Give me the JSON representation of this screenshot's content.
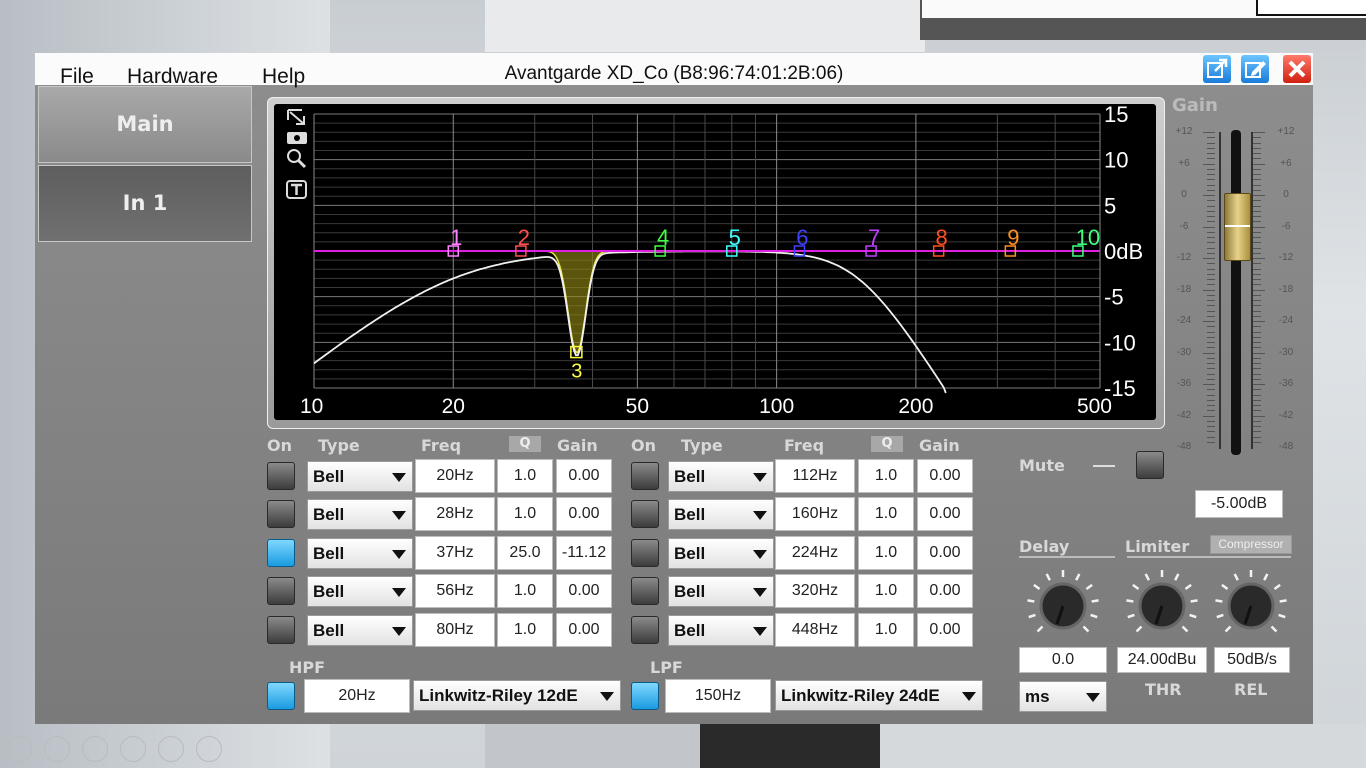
{
  "window": {
    "title": "Avantgarde XD_Co (B8:96:74:01:2B:06)",
    "menu": [
      "File",
      "Hardware",
      "Help"
    ]
  },
  "sidebar": {
    "tabs": [
      "Main",
      "In 1"
    ]
  },
  "graph": {
    "y_ticks": [
      "15",
      "10",
      "5",
      "0dB",
      "-5",
      "-10",
      "-15"
    ],
    "x_ticks": [
      "10",
      "20",
      "50",
      "100",
      "200",
      "500"
    ],
    "markers": [
      {
        "label": "1",
        "color": "#ff80ff",
        "freq": 20,
        "gain": 0
      },
      {
        "label": "2",
        "color": "#ff5050",
        "freq": 28,
        "gain": 0
      },
      {
        "label": "3",
        "color": "#ffff40",
        "freq": 37,
        "gain": -11.12
      },
      {
        "label": "4",
        "color": "#40ff40",
        "freq": 56,
        "gain": 0
      },
      {
        "label": "5",
        "color": "#40ffff",
        "freq": 80,
        "gain": 0
      },
      {
        "label": "6",
        "color": "#4040ff",
        "freq": 112,
        "gain": 0
      },
      {
        "label": "7",
        "color": "#c040ff",
        "freq": 160,
        "gain": 0
      },
      {
        "label": "8",
        "color": "#ff5020",
        "freq": 224,
        "gain": 0
      },
      {
        "label": "9",
        "color": "#ff9020",
        "freq": 320,
        "gain": 0
      },
      {
        "label": "10",
        "color": "#40ff80",
        "freq": 448,
        "gain": 0
      }
    ],
    "tool_icons": [
      "expand-icon",
      "camera-icon",
      "zoom-icon",
      "text-icon"
    ]
  },
  "eq_headers": {
    "on": "On",
    "type": "Type",
    "freq": "Freq",
    "q": "Q",
    "gain": "Gain"
  },
  "eq_left": [
    {
      "on": false,
      "type": "Bell",
      "freq": "20Hz",
      "q": "1.0",
      "gain": "0.00"
    },
    {
      "on": false,
      "type": "Bell",
      "freq": "28Hz",
      "q": "1.0",
      "gain": "0.00"
    },
    {
      "on": true,
      "type": "Bell",
      "freq": "37Hz",
      "q": "25.0",
      "gain": "-11.12"
    },
    {
      "on": false,
      "type": "Bell",
      "freq": "56Hz",
      "q": "1.0",
      "gain": "0.00"
    },
    {
      "on": false,
      "type": "Bell",
      "freq": "80Hz",
      "q": "1.0",
      "gain": "0.00"
    }
  ],
  "eq_right": [
    {
      "on": false,
      "type": "Bell",
      "freq": "112Hz",
      "q": "1.0",
      "gain": "0.00"
    },
    {
      "on": false,
      "type": "Bell",
      "freq": "160Hz",
      "q": "1.0",
      "gain": "0.00"
    },
    {
      "on": false,
      "type": "Bell",
      "freq": "224Hz",
      "q": "1.0",
      "gain": "0.00"
    },
    {
      "on": false,
      "type": "Bell",
      "freq": "320Hz",
      "q": "1.0",
      "gain": "0.00"
    },
    {
      "on": false,
      "type": "Bell",
      "freq": "448Hz",
      "q": "1.0",
      "gain": "0.00"
    }
  ],
  "hpf": {
    "label": "HPF",
    "on": true,
    "freq": "20Hz",
    "type": "Linkwitz-Riley 12dE"
  },
  "lpf": {
    "label": "LPF",
    "on": true,
    "freq": "150Hz",
    "type": "Linkwitz-Riley 24dE"
  },
  "gain": {
    "label": "Gain",
    "scale": [
      "+12",
      "+6",
      "0",
      "-6",
      "-12",
      "-18",
      "-24",
      "-30",
      "-36",
      "-42",
      "-48"
    ],
    "value": "-5.00dB",
    "fader_db": -5
  },
  "mute": {
    "label": "Mute",
    "on": false
  },
  "delay": {
    "label": "Delay",
    "value": "0.0",
    "unit": "ms"
  },
  "limiter": {
    "label": "Limiter",
    "compressor_label": "Compressor",
    "thr_value": "24.00dBu",
    "thr_label": "THR",
    "rel_value": "50dB/s",
    "rel_label": "REL"
  }
}
